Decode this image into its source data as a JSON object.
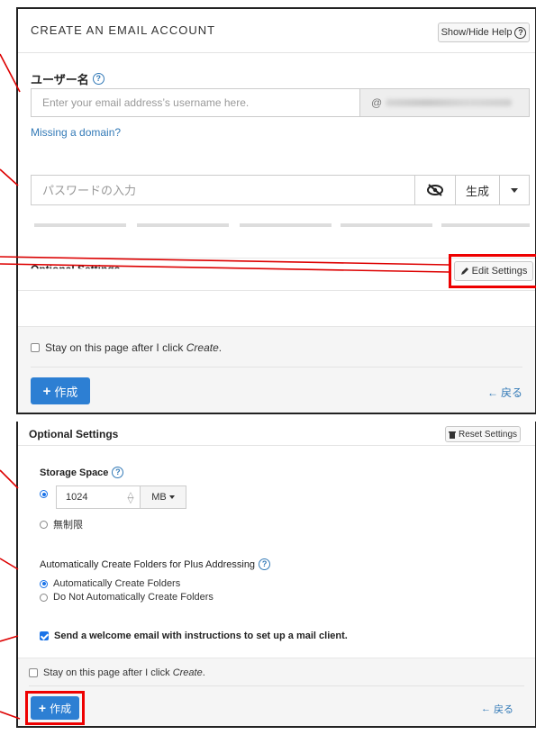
{
  "top": {
    "title": "CREATE AN EMAIL ACCOUNT",
    "show_hide_help": "Show/Hide Help",
    "username_label": "ユーザー名",
    "username_placeholder": "Enter your email address’s username here.",
    "domain_prefix": "@",
    "missing_domain": "Missing a domain?",
    "password_placeholder": "パスワードの入力",
    "generate_label": "生成",
    "optional_settings": "Optional Settings",
    "edit_settings": "Edit Settings",
    "stay_on_page_pre": "Stay on this page after I click ",
    "stay_on_page_em": "Create",
    "stay_on_page_post": ".",
    "create_button": "作成",
    "back_link": "戻る"
  },
  "bottom": {
    "optional_settings": "Optional Settings",
    "reset_settings": "Reset Settings",
    "storage_label": "Storage Space",
    "storage_value": "1024",
    "storage_unit": "MB",
    "unlimited_label": "無制限",
    "plus_label": "Automatically Create Folders for Plus Addressing",
    "auto_create": "Automatically Create Folders",
    "no_auto_create": "Do Not Automatically Create Folders",
    "welcome_email": "Send a welcome email with instructions to set up a mail client.",
    "stay_on_page_pre": "Stay on this page after I click ",
    "stay_on_page_em": "Create",
    "stay_on_page_post": ".",
    "create_button": "作成",
    "back_link": "戻る"
  },
  "colors": {
    "accent": "#2d7fd3",
    "link": "#337ab7",
    "highlight": "#e00000"
  }
}
